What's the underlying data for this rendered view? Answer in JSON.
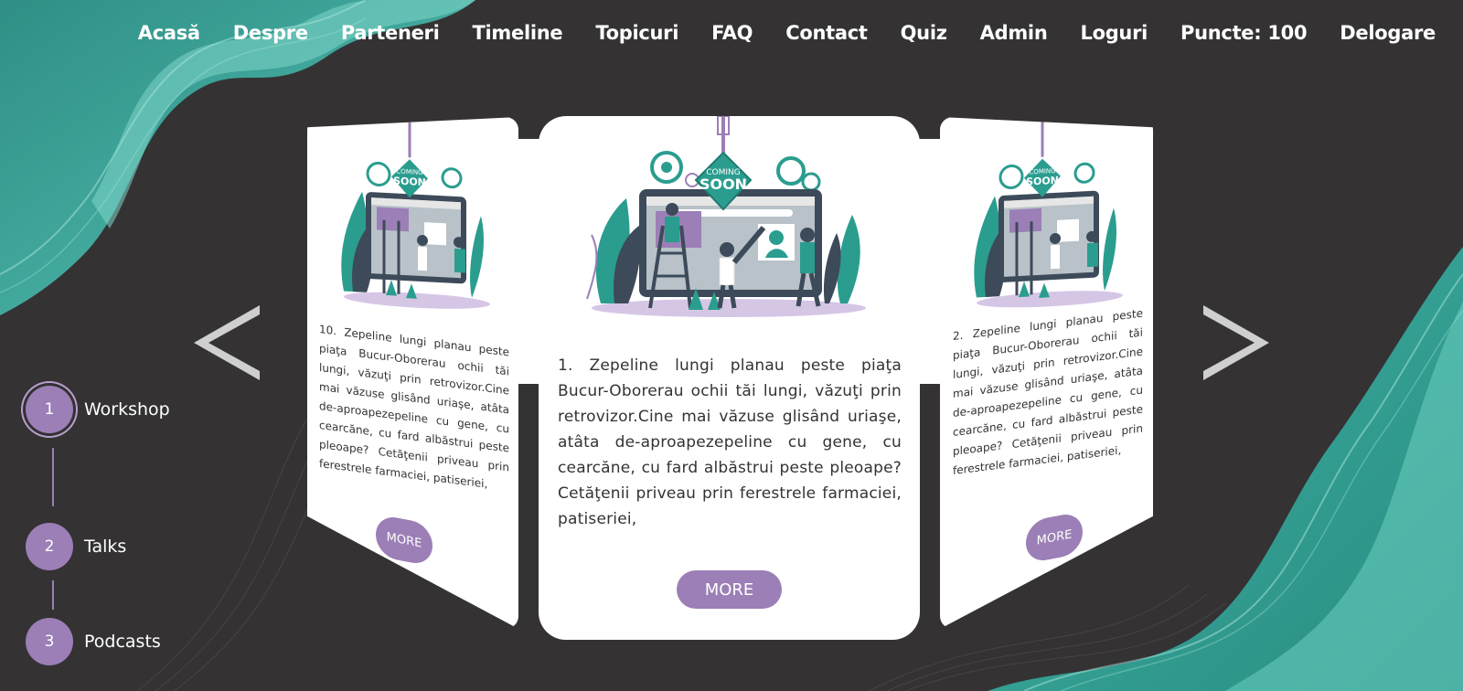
{
  "nav": {
    "items": [
      {
        "label": "Acasă",
        "name": "nav-acasa"
      },
      {
        "label": "Despre",
        "name": "nav-despre"
      },
      {
        "label": "Parteneri",
        "name": "nav-parteneri"
      },
      {
        "label": "Timeline",
        "name": "nav-timeline"
      },
      {
        "label": "Topicuri",
        "name": "nav-topicuri"
      },
      {
        "label": "FAQ",
        "name": "nav-faq"
      },
      {
        "label": "Contact",
        "name": "nav-contact"
      },
      {
        "label": "Quiz",
        "name": "nav-quiz"
      },
      {
        "label": "Admin",
        "name": "nav-admin"
      },
      {
        "label": "Loguri",
        "name": "nav-loguri"
      },
      {
        "label": "Puncte: 100",
        "name": "nav-puncte"
      },
      {
        "label": "Delogare",
        "name": "nav-delogare"
      }
    ]
  },
  "steps": [
    {
      "number": "1",
      "label": "Workshop",
      "active": true
    },
    {
      "number": "2",
      "label": "Talks",
      "active": false
    },
    {
      "number": "3",
      "label": "Podcasts",
      "active": false
    }
  ],
  "carousel": {
    "prev_icon": "chevron-left-icon",
    "next_icon": "chevron-right-icon",
    "image_icon": "coming-soon-illustration",
    "image_text_top": "COMING",
    "image_text_bottom": "SOON",
    "cards": {
      "left": {
        "text": "10. Zepeline lungi planau peste piaţa Bucur-Oborerau ochii tăi lungi, văzuţi prin retrovizor.Cine mai văzuse glisând uriaşe, atâta de-aproapezepeline cu gene, cu cearcăne, cu fard albăstrui peste pleoape? Cetăţenii priveau prin ferestrele farmaciei, patiseriei,",
        "button": "MORE"
      },
      "center": {
        "text": "1. Zepeline lungi planau peste piaţa Bucur-Oborerau ochii tăi lungi, văzuţi prin retrovizor.Cine mai văzuse glisând uriaşe, atâta de-aproapezepeline cu gene, cu cearcăne, cu fard albăstrui peste pleoape? Cetăţenii priveau prin ferestrele farmaciei, patiseriei,",
        "button": "MORE"
      },
      "right": {
        "text": "2. Zepeline lungi planau peste piaţa Bucur-Oborerau ochii tăi lungi, văzuţi prin retrovizor.Cine mai văzuse glisând uriaşe, atâta de-aproapezepeline cu gene, cu cearcăne, cu fard albăstrui peste pleoape? Cetăţenii priveau prin ferestrele farmaciei, patiseriei,",
        "button": "MORE"
      }
    }
  },
  "colors": {
    "background": "#343233",
    "accent": "#9b7fb6",
    "teal": "#2a9d8f"
  }
}
